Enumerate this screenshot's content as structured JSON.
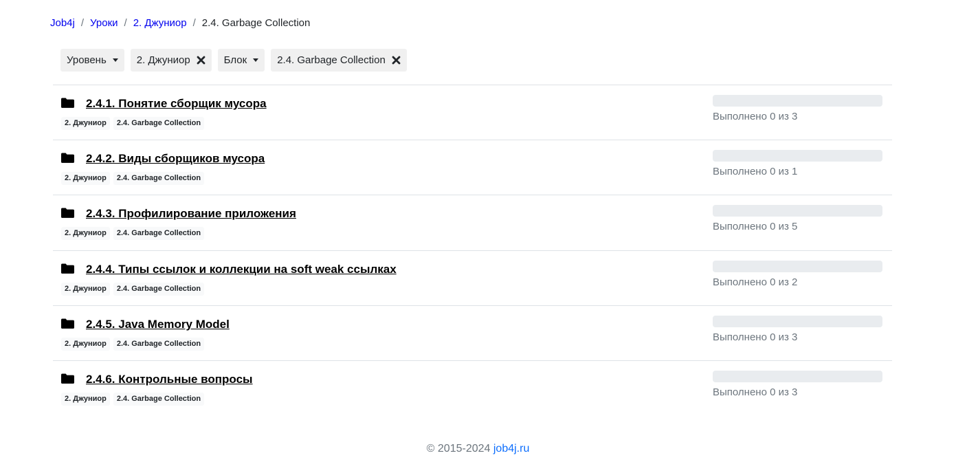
{
  "breadcrumb": {
    "items": [
      "Job4j",
      "Уроки",
      "2. Джуниор"
    ],
    "separator": "/",
    "current": "2.4. Garbage Collection"
  },
  "filters": {
    "level_label": "Уровень",
    "level_value": "2. Джуниор",
    "block_label": "Блок",
    "block_value": "2.4. Garbage Collection"
  },
  "topics": [
    {
      "title": "2.4.1. Понятие сборщик мусора",
      "tags": [
        "2. Джуниор",
        "2.4. Garbage Collection"
      ],
      "progress": 0,
      "status": "Выполнено 0 из 3"
    },
    {
      "title": "2.4.2. Виды сборщиков мусора",
      "tags": [
        "2. Джуниор",
        "2.4. Garbage Collection"
      ],
      "progress": 0,
      "status": "Выполнено 0 из 1"
    },
    {
      "title": "2.4.3. Профилирование приложения",
      "tags": [
        "2. Джуниор",
        "2.4. Garbage Collection"
      ],
      "progress": 0,
      "status": "Выполнено 0 из 5"
    },
    {
      "title": "2.4.4. Типы ссылок и коллекции на soft weak ссылках",
      "tags": [
        "2. Джуниор",
        "2.4. Garbage Collection"
      ],
      "progress": 0,
      "status": "Выполнено 0 из 2"
    },
    {
      "title": "2.4.5. Java Memory Model",
      "tags": [
        "2. Джуниор",
        "2.4. Garbage Collection"
      ],
      "progress": 0,
      "status": "Выполнено 0 из 3"
    },
    {
      "title": "2.4.6. Контрольные вопросы",
      "tags": [
        "2. Джуниор",
        "2.4. Garbage Collection"
      ],
      "progress": 0,
      "status": "Выполнено 0 из 3"
    }
  ],
  "footer": {
    "copyright": "© 2015-2024",
    "link": "job4j.ru"
  },
  "icons": {
    "topic": "folder-icon",
    "remove": "close-icon",
    "dropdown": "caret-down-icon"
  },
  "colors": {
    "link": "#0000ee",
    "footer_link": "#0d6efd",
    "progress_track": "#e9ecef"
  }
}
